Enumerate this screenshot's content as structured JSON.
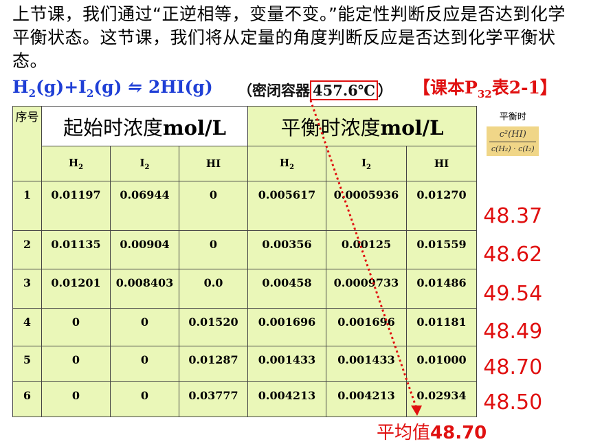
{
  "intro_text": "上节课，我们通过“正逆相等，变量不变。”能定性判断反应是否达到化学平衡状态。这节课，我们将从定量的角度判断反应是否达到化学平衡状态。",
  "equation": {
    "left_h": "H",
    "left_h_sub": "2",
    "left_mid": "(g)+I",
    "left_i_sub": "2",
    "left_end": "(g)",
    "arrow": "⇋",
    "right": "2HI(g)"
  },
  "condition": {
    "open": "（密闭容器",
    "temp": "457.6℃",
    "close": "）"
  },
  "reference": {
    "pre": "【课本P",
    "sub": "32",
    "post": "表2-1】"
  },
  "table": {
    "seq_header": "序号",
    "initial_header": "起始时浓度",
    "initial_unit": "mol/L",
    "equil_header": "平衡时浓度",
    "equil_unit": "mol/L",
    "k_header": "平衡时",
    "k_formula_num": "c²(HI)",
    "k_formula_den": "c(H₂) · c(I₂)",
    "sub_headers": {
      "h2": "H",
      "i2": "I",
      "hi": "HI",
      "sub2": "2"
    },
    "rows": [
      {
        "seq": "1",
        "h2_0": "0.01197",
        "i2_0": "0.06944",
        "hi_0": "0",
        "h2": "0.005617",
        "i2": "0.0005936",
        "hi": "0.01270",
        "k": "48.37"
      },
      {
        "seq": "2",
        "h2_0": "0.01135",
        "i2_0": "0.00904",
        "hi_0": "0",
        "h2": "0.00356",
        "i2": "0.00125",
        "hi": "0.01559",
        "k": "48.62"
      },
      {
        "seq": "3",
        "h2_0": "0.01201",
        "i2_0": "0.008403",
        "hi_0": "0.0",
        "h2": "0.00458",
        "i2": "0.0009733",
        "hi": "0.01486",
        "k": "49.54"
      },
      {
        "seq": "4",
        "h2_0": "0",
        "i2_0": "0",
        "hi_0": "0.01520",
        "h2": "0.001696",
        "i2": "0.001696",
        "hi": "0.01181",
        "k": "48.49"
      },
      {
        "seq": "5",
        "h2_0": "0",
        "i2_0": "0",
        "hi_0": "0.01287",
        "h2": "0.001433",
        "i2": "0.001433",
        "hi": "0.01000",
        "k": "48.70"
      },
      {
        "seq": "6",
        "h2_0": "0",
        "i2_0": "0",
        "hi_0": "0.03777",
        "h2": "0.004213",
        "i2": "0.004213",
        "hi": "0.02934",
        "k": "48.50"
      }
    ]
  },
  "average": {
    "label": "平均值",
    "value": "48.70"
  },
  "colors": {
    "accent_red": "#e01010",
    "equation_blue": "#1f3fd6",
    "equilibrium_fill": "#eaf7b8",
    "formula_fill": "#f0d688"
  }
}
